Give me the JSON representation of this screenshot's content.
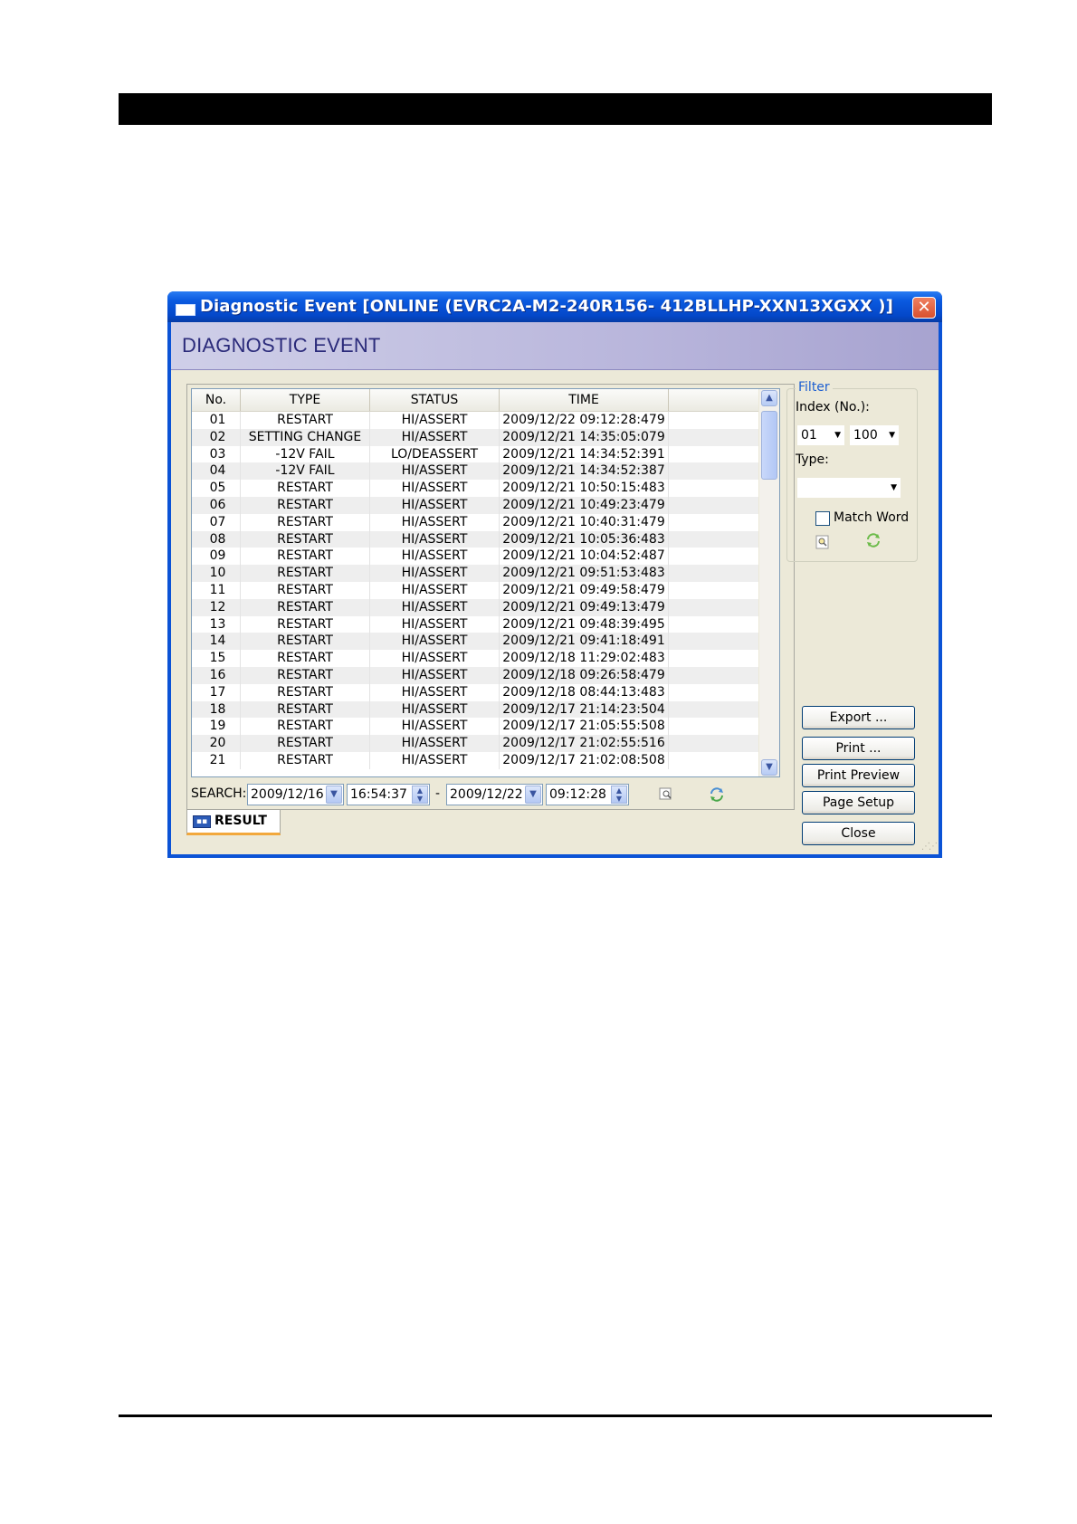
{
  "window": {
    "title": "Diagnostic Event [ONLINE (EVRC2A-M2-240R156-  412BLLHP-XXN13XGXX )]",
    "close_label": "✕"
  },
  "banner": {
    "title": "DIAGNOSTIC EVENT"
  },
  "table": {
    "columns": [
      "No.",
      "TYPE",
      "STATUS",
      "TIME"
    ],
    "rows": [
      {
        "no": "01",
        "type": "RESTART",
        "status": "HI/ASSERT",
        "time": "2009/12/22 09:12:28:479"
      },
      {
        "no": "02",
        "type": "SETTING CHANGE",
        "status": "HI/ASSERT",
        "time": "2009/12/21 14:35:05:079"
      },
      {
        "no": "03",
        "type": "-12V FAIL",
        "status": "LO/DEASSERT",
        "time": "2009/12/21 14:34:52:391"
      },
      {
        "no": "04",
        "type": "-12V FAIL",
        "status": "HI/ASSERT",
        "time": "2009/12/21 14:34:52:387"
      },
      {
        "no": "05",
        "type": "RESTART",
        "status": "HI/ASSERT",
        "time": "2009/12/21 10:50:15:483"
      },
      {
        "no": "06",
        "type": "RESTART",
        "status": "HI/ASSERT",
        "time": "2009/12/21 10:49:23:479"
      },
      {
        "no": "07",
        "type": "RESTART",
        "status": "HI/ASSERT",
        "time": "2009/12/21 10:40:31:479"
      },
      {
        "no": "08",
        "type": "RESTART",
        "status": "HI/ASSERT",
        "time": "2009/12/21 10:05:36:483"
      },
      {
        "no": "09",
        "type": "RESTART",
        "status": "HI/ASSERT",
        "time": "2009/12/21 10:04:52:487"
      },
      {
        "no": "10",
        "type": "RESTART",
        "status": "HI/ASSERT",
        "time": "2009/12/21 09:51:53:483"
      },
      {
        "no": "11",
        "type": "RESTART",
        "status": "HI/ASSERT",
        "time": "2009/12/21 09:49:58:479"
      },
      {
        "no": "12",
        "type": "RESTART",
        "status": "HI/ASSERT",
        "time": "2009/12/21 09:49:13:479"
      },
      {
        "no": "13",
        "type": "RESTART",
        "status": "HI/ASSERT",
        "time": "2009/12/21 09:48:39:495"
      },
      {
        "no": "14",
        "type": "RESTART",
        "status": "HI/ASSERT",
        "time": "2009/12/21 09:41:18:491"
      },
      {
        "no": "15",
        "type": "RESTART",
        "status": "HI/ASSERT",
        "time": "2009/12/18 11:29:02:483"
      },
      {
        "no": "16",
        "type": "RESTART",
        "status": "HI/ASSERT",
        "time": "2009/12/18 09:26:58:479"
      },
      {
        "no": "17",
        "type": "RESTART",
        "status": "HI/ASSERT",
        "time": "2009/12/18 08:44:13:483"
      },
      {
        "no": "18",
        "type": "RESTART",
        "status": "HI/ASSERT",
        "time": "2009/12/17 21:14:23:504"
      },
      {
        "no": "19",
        "type": "RESTART",
        "status": "HI/ASSERT",
        "time": "2009/12/17 21:05:55:508"
      },
      {
        "no": "20",
        "type": "RESTART",
        "status": "HI/ASSERT",
        "time": "2009/12/17 21:02:55:516"
      },
      {
        "no": "21",
        "type": "RESTART",
        "status": "HI/ASSERT",
        "time": "2009/12/17 21:02:08:508"
      }
    ]
  },
  "search": {
    "label": "SEARCH:",
    "start_date": "2009/12/16",
    "start_time": "16:54:37",
    "separator": "-",
    "end_date": "2009/12/22",
    "end_time": "09:12:28"
  },
  "tab": {
    "label": "RESULT"
  },
  "filter": {
    "title": "Filter",
    "index_label": "Index (No.):",
    "index_from": "01",
    "index_to": "100",
    "type_label": "Type:",
    "type_value": "",
    "match_word_label": "Match Word",
    "match_word_checked": false
  },
  "buttons": {
    "export": "Export ...",
    "print": "Print ...",
    "print_preview": "Print Preview",
    "page_setup": "Page Setup",
    "close": "Close"
  },
  "icons": {
    "find": "magnifier-icon",
    "refresh": "refresh-icon"
  }
}
